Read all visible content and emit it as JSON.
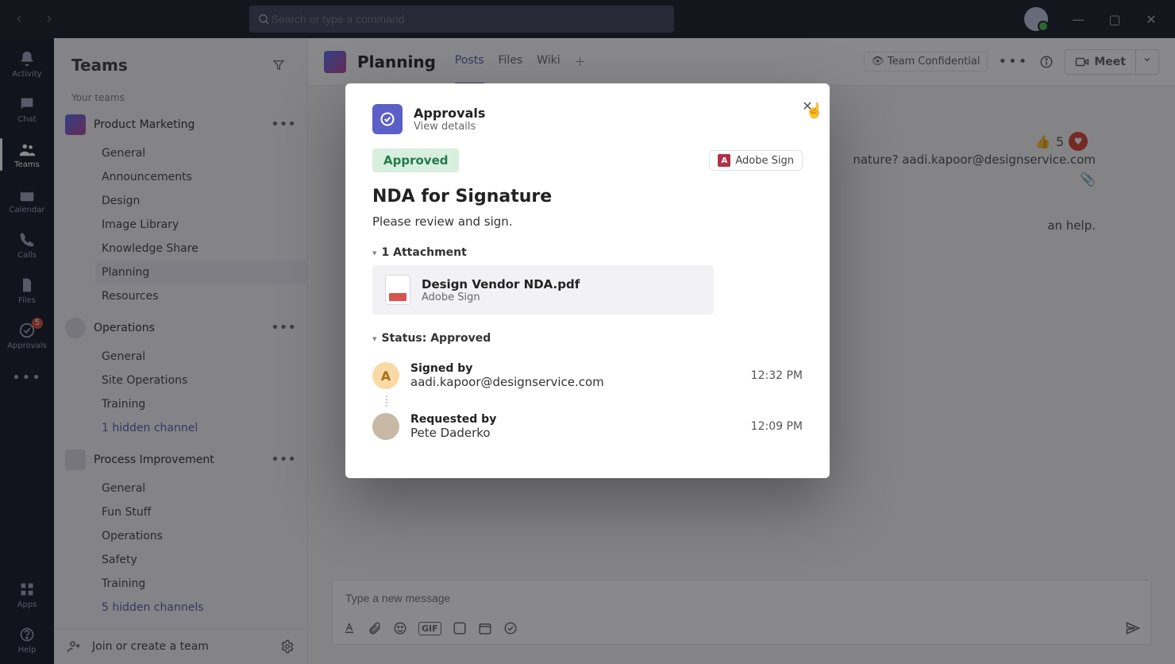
{
  "titlebar": {
    "search_placeholder": "Search or type a command"
  },
  "window_controls": {
    "min": "—",
    "max": "▢",
    "close": "✕"
  },
  "rail": {
    "items": [
      {
        "id": "activity",
        "label": "Activity",
        "icon": "🔔",
        "badge": ""
      },
      {
        "id": "chat",
        "label": "Chat",
        "icon": "💬",
        "badge": ""
      },
      {
        "id": "teams",
        "label": "Teams",
        "icon": "👥",
        "badge": "",
        "active": true
      },
      {
        "id": "calendar",
        "label": "Calendar",
        "icon": "📅",
        "badge": ""
      },
      {
        "id": "calls",
        "label": "Calls",
        "icon": "📞",
        "badge": ""
      },
      {
        "id": "files",
        "label": "Files",
        "icon": "📄",
        "badge": ""
      },
      {
        "id": "approvals",
        "label": "Approvals",
        "icon": "✔",
        "badge": "5"
      }
    ],
    "more": "•••",
    "apps_label": "Apps",
    "help_label": "Help"
  },
  "sidebar": {
    "title": "Teams",
    "your_teams_label": "Your teams",
    "teams": [
      {
        "name": "Product Marketing",
        "icon_color": "linear-gradient(135deg,#4f6bed,#b84592)",
        "channels": [
          "General",
          "Announcements",
          "Design",
          "Image Library",
          "Knowledge Share",
          "Planning",
          "Resources"
        ],
        "selected": "Planning"
      },
      {
        "name": "Operations",
        "icon_color": "#d8d8de",
        "channels": [
          "General",
          "Site Operations",
          "Training"
        ],
        "hidden": "1 hidden channel"
      },
      {
        "name": "Process Improvement",
        "icon_color": "#d8d8de",
        "channels": [
          "General",
          "Fun Stuff",
          "Operations",
          "Safety",
          "Training"
        ],
        "hidden": "5 hidden channels"
      }
    ],
    "join_create": "Join or create a team"
  },
  "channel_header": {
    "name": "Planning",
    "tabs": [
      "Posts",
      "Files",
      "Wiki"
    ],
    "active_tab": "Posts",
    "privacy": "Team",
    "classification": "Confidential",
    "meet": "Meet"
  },
  "message_bg": {
    "line1": "nature? aadi.kapoor@designservice.com",
    "line2": "an help.",
    "reaction_count": "5"
  },
  "compose": {
    "placeholder": "Type a new message"
  },
  "modal": {
    "app_name": "Approvals",
    "subtitle": "View details",
    "status": "Approved",
    "adobe": "Adobe Sign",
    "title": "NDA for Signature",
    "description": "Please review and sign.",
    "attachments_header": "1 Attachment",
    "attachment": {
      "filename": "Design Vendor NDA.pdf",
      "source": "Adobe Sign"
    },
    "status_header": "Status: Approved",
    "timeline": [
      {
        "label": "Signed by",
        "value": "aadi.kapoor@designservice.com",
        "time": "12:32 PM",
        "avatar": "A",
        "type": "letter"
      },
      {
        "label": "Requested by",
        "value": "Pete Daderko",
        "time": "12:09 PM",
        "avatar": "",
        "type": "photo"
      }
    ]
  }
}
